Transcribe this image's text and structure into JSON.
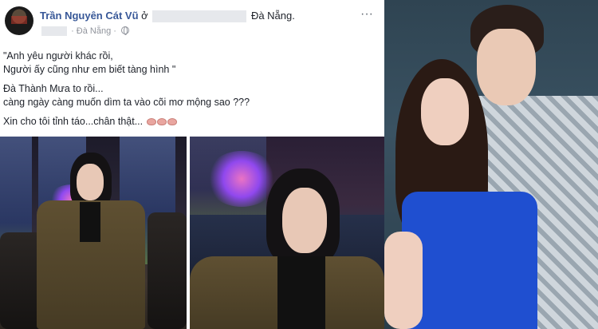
{
  "post": {
    "author": "Trần Nguyên Cát Vũ",
    "at_word": "ở",
    "location_city": "Đà Nẵng.",
    "meta_city": "Đà Nẵng",
    "meta_separator": "·",
    "more_glyph": "···",
    "lines": [
      "\"Anh yêu người khác rồi,",
      "Người ấy cũng như em biết tàng hình \"",
      "Đà Thành Mưa to rồi...",
      "càng ngày càng muốn dìm ta vào cõi mơ mộng sao ???",
      "Xin cho tôi tỉnh táo...chân thật..."
    ],
    "icons": {
      "avatar": "avatar-photo",
      "privacy": "globe-icon",
      "more": "more-options-icon",
      "emoji": "brain-emoji"
    }
  },
  "colors": {
    "author": "#385898",
    "text": "#1d2129",
    "meta": "#90949c",
    "redacted": "#e6e8ec"
  }
}
